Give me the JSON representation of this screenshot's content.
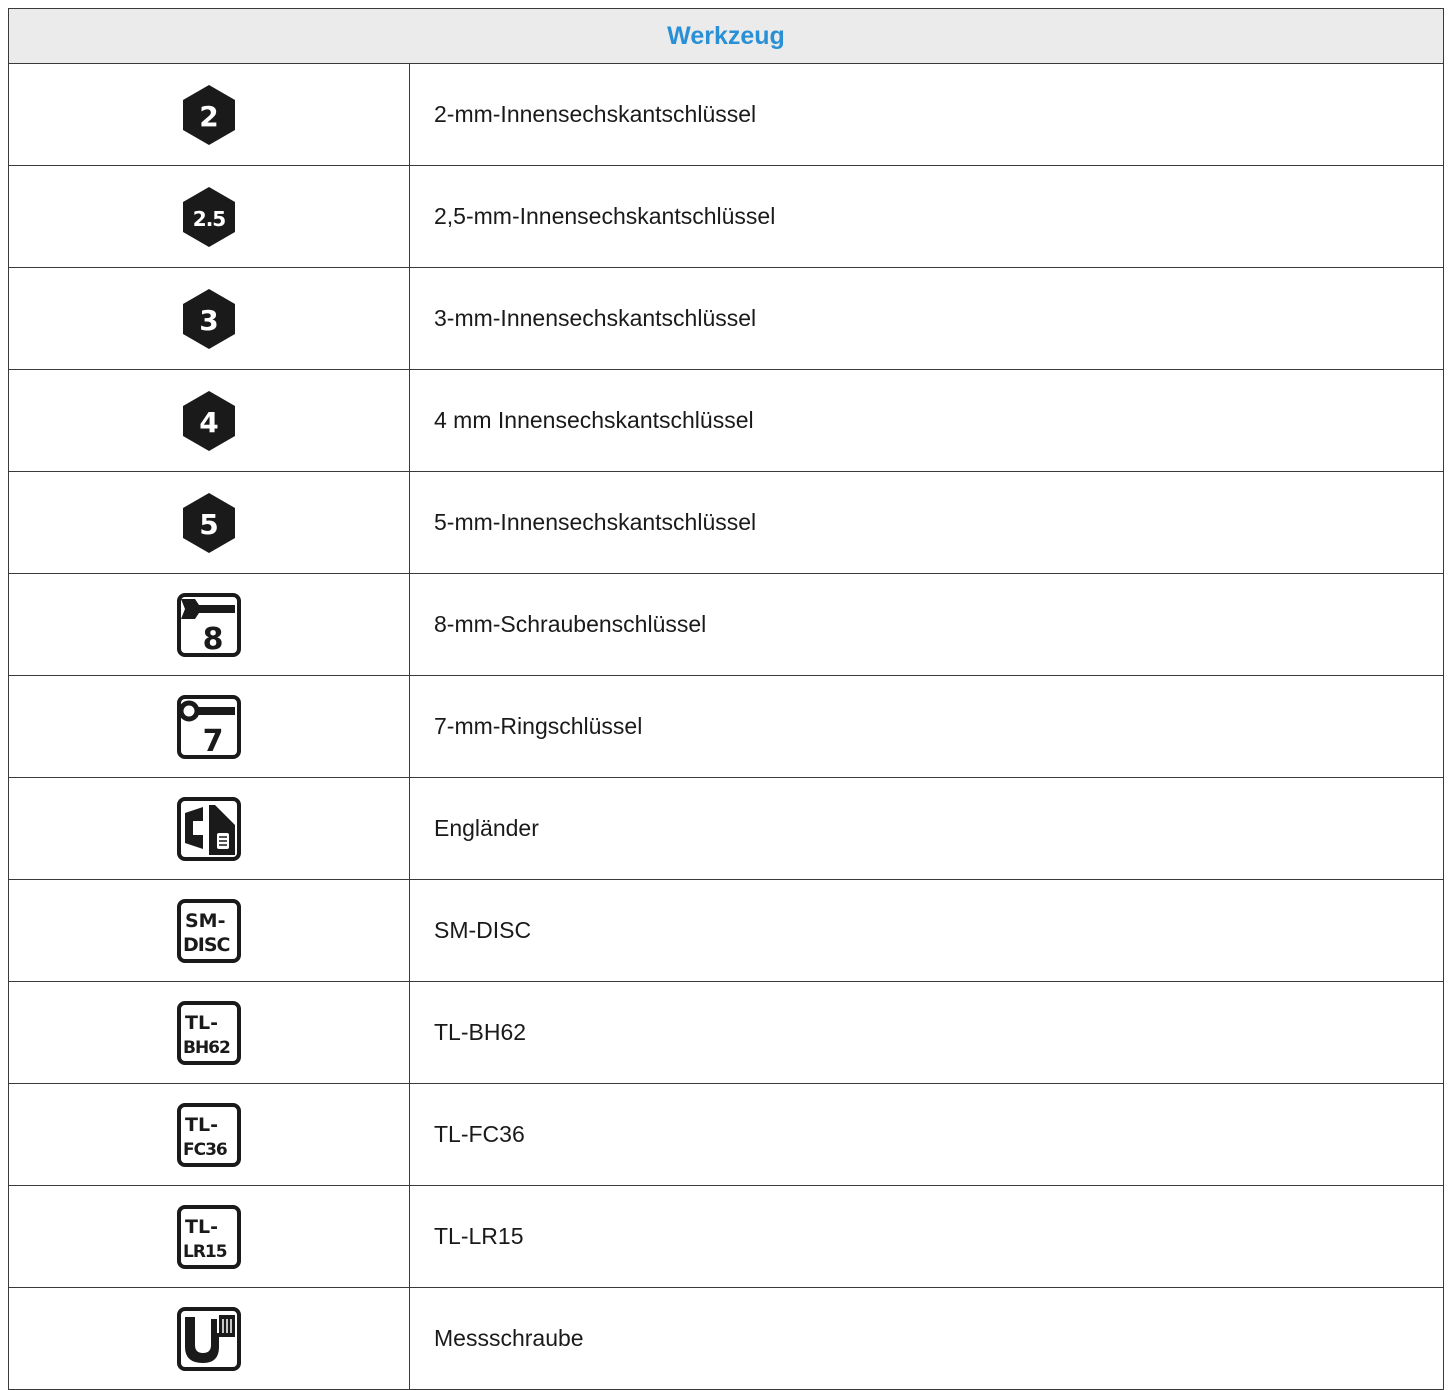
{
  "header": {
    "title": "Werkzeug"
  },
  "tools": [
    {
      "icon": "hex-2-icon",
      "glyph": "2",
      "name": "2-mm-Innensechskantschlüssel"
    },
    {
      "icon": "hex-2-5-icon",
      "glyph": "2.5",
      "name": "2,5-mm-Innensechskantschlüssel"
    },
    {
      "icon": "hex-3-icon",
      "glyph": "3",
      "name": "3-mm-Innensechskantschlüssel"
    },
    {
      "icon": "hex-4-icon",
      "glyph": "4",
      "name": "4 mm Innensechskantschlüssel"
    },
    {
      "icon": "hex-5-icon",
      "glyph": "5",
      "name": "5-mm-Innensechskantschlüssel"
    },
    {
      "icon": "spanner-8-icon",
      "glyph": "8",
      "name": "8-mm-Schraubenschlüssel"
    },
    {
      "icon": "ring-spanner-7-icon",
      "glyph": "7",
      "name": "7-mm-Ringschlüssel"
    },
    {
      "icon": "adjustable-wrench-icon",
      "name": "Engländer"
    },
    {
      "icon": "sm-disc-tool-icon",
      "glyph_line1": "SM-",
      "glyph_line2": "DISC",
      "name": "SM-DISC"
    },
    {
      "icon": "tl-bh62-tool-icon",
      "glyph_line1": "TL-",
      "glyph_line2": "BH62",
      "name": "TL-BH62"
    },
    {
      "icon": "tl-fc36-tool-icon",
      "glyph_line1": "TL-",
      "glyph_line2": "FC36",
      "name": "TL-FC36"
    },
    {
      "icon": "tl-lr15-tool-icon",
      "glyph_line1": "TL-",
      "glyph_line2": "LR15",
      "name": "TL-LR15"
    },
    {
      "icon": "micrometer-icon",
      "name": "Messschraube"
    }
  ],
  "colors": {
    "header_text": "#2a90d6",
    "header_bg": "#ebebeb",
    "border": "#3a3a3a",
    "icon": "#1a1a1a"
  }
}
